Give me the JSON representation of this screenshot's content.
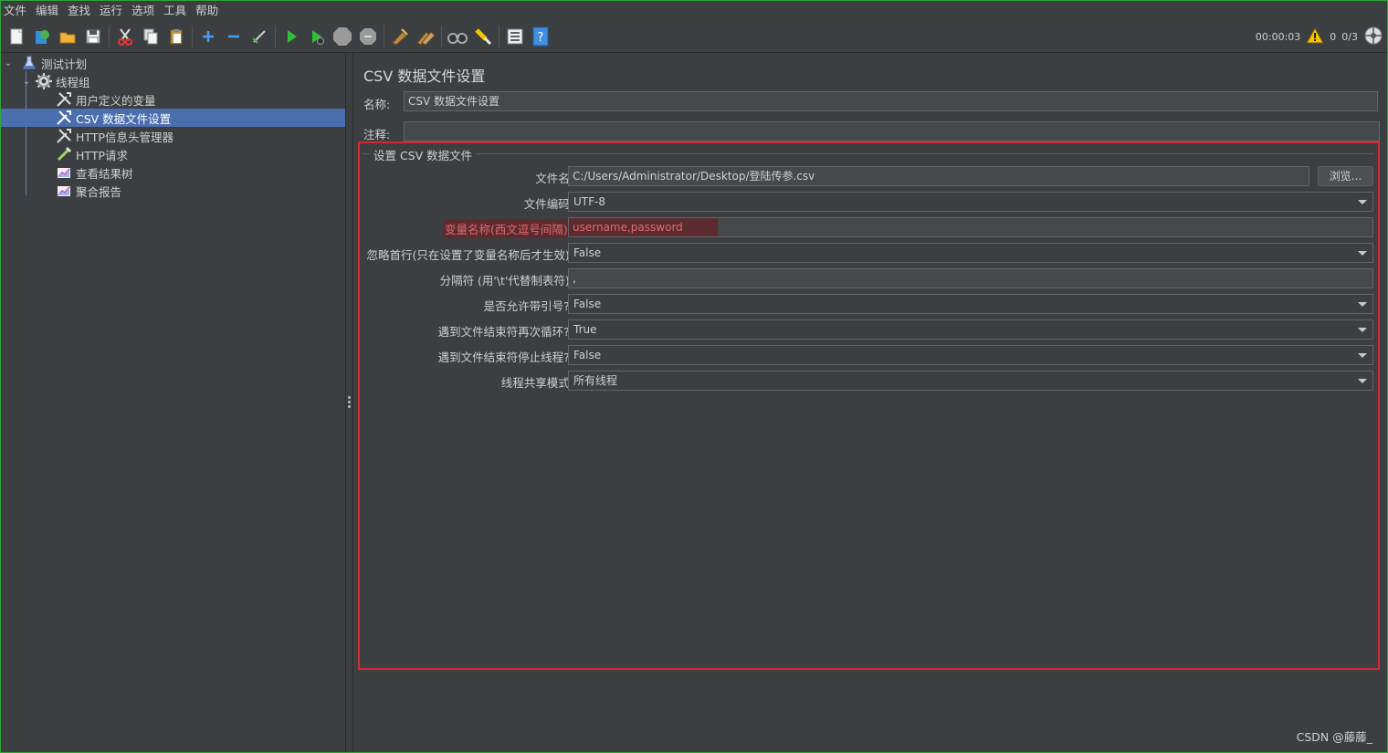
{
  "menu": [
    "文件",
    "编辑",
    "查找",
    "运行",
    "选项",
    "工具",
    "帮助"
  ],
  "toolbar_icons": [
    "new-icon",
    "templates-icon",
    "open-icon",
    "save-icon",
    "cut-icon",
    "copy-icon",
    "paste-icon",
    "expand-icon",
    "collapse-icon",
    "toggle-icon",
    "start-icon",
    "start-no-pause-icon",
    "stop-icon",
    "shutdown-icon",
    "clear-icon",
    "clear-all-icon",
    "search-icon",
    "reset-search-icon",
    "function-helper-icon",
    "help-icon"
  ],
  "status": {
    "timer": "00:00:03",
    "warnings": "0",
    "threads": "0/3"
  },
  "tree": {
    "items": [
      {
        "label": "测试计划",
        "icon": "test-plan-icon",
        "level": 0,
        "expanded": true,
        "selected": false
      },
      {
        "label": "线程组",
        "icon": "thread-group-gear-icon",
        "level": 1,
        "expanded": true,
        "selected": false
      },
      {
        "label": "用户定义的变量",
        "icon": "config-element-icon",
        "level": 2,
        "selected": false
      },
      {
        "label": "CSV 数据文件设置",
        "icon": "config-element-icon",
        "level": 2,
        "selected": true
      },
      {
        "label": "HTTP信息头管理器",
        "icon": "config-element-icon",
        "level": 2,
        "selected": false
      },
      {
        "label": "HTTP请求",
        "icon": "sampler-pipette-icon",
        "level": 2,
        "selected": false
      },
      {
        "label": "查看结果树",
        "icon": "listener-chart-icon",
        "level": 2,
        "selected": false
      },
      {
        "label": "聚合报告",
        "icon": "listener-chart-icon",
        "level": 2,
        "selected": false
      }
    ]
  },
  "panel": {
    "title": "CSV 数据文件设置",
    "name_label": "名称:",
    "name_value": "CSV 数据文件设置",
    "comment_label": "注释:",
    "comment_value": "",
    "group_title": "设置 CSV 数据文件",
    "browse_label": "浏览...",
    "rows": [
      {
        "label": "文件名:",
        "value": "C:/Users/Administrator/Desktop/登陆传参.csv",
        "kind": "text"
      },
      {
        "label": "文件编码:",
        "value": "UTF-8",
        "kind": "combo"
      },
      {
        "label": "变量名称(西文逗号间隔):",
        "value": "username,password",
        "kind": "text-error"
      },
      {
        "label": "忽略首行(只在设置了变量名称后才生效):",
        "value": "False",
        "kind": "combo"
      },
      {
        "label": "分隔符 (用'\\t'代替制表符):",
        "value": ",",
        "kind": "text"
      },
      {
        "label": "是否允许带引号?:",
        "value": "False",
        "kind": "combo"
      },
      {
        "label": "遇到文件结束符再次循环?:",
        "value": "True",
        "kind": "combo"
      },
      {
        "label": "遇到文件结束符停止线程?:",
        "value": "False",
        "kind": "combo"
      },
      {
        "label": "线程共享模式:",
        "value": "所有线程",
        "kind": "combo"
      }
    ]
  },
  "watermark": "CSDN @藤藤_",
  "colors": {
    "selection": "#4b6eaf",
    "highlight_box": "#d42a35",
    "error_text": "#e06a6d",
    "error_bg": "#5c2b2f",
    "start_green": "#2fbf3a"
  }
}
